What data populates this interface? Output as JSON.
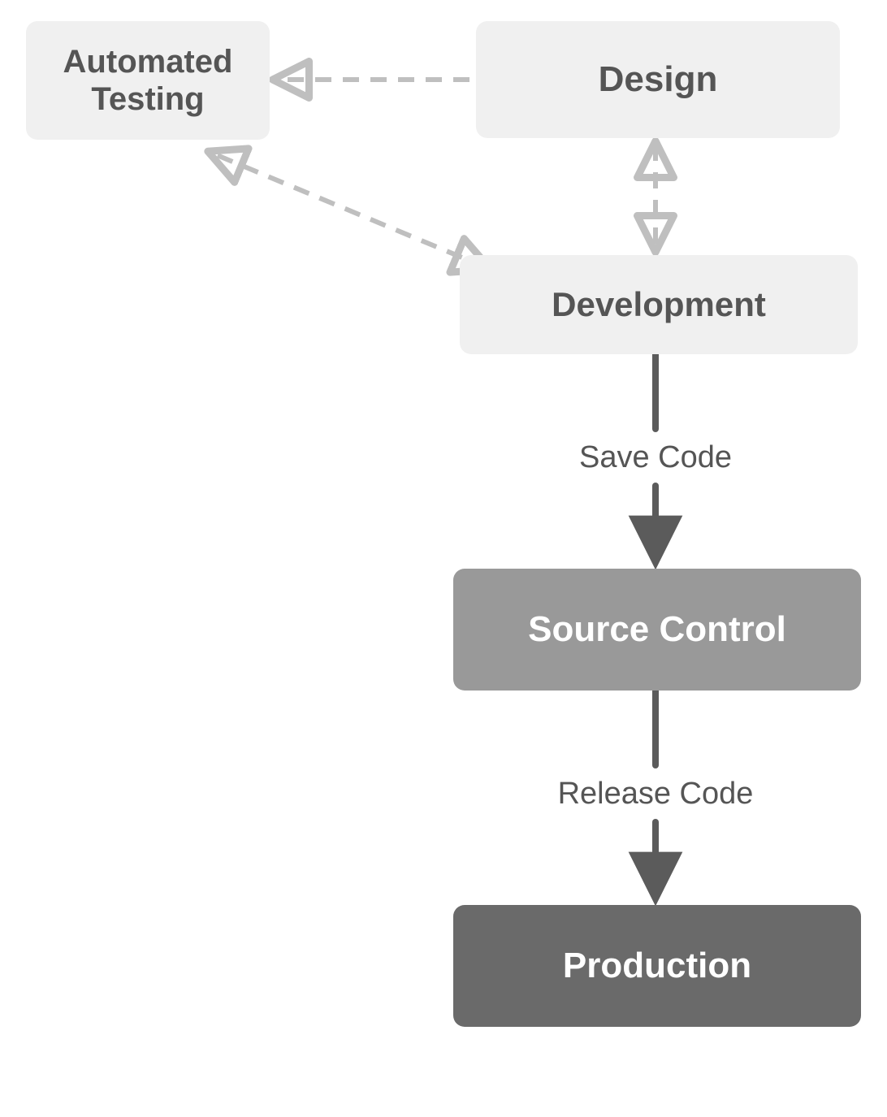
{
  "nodes": {
    "automated_testing": {
      "label": "Automated\nTesting"
    },
    "design": {
      "label": "Design"
    },
    "development": {
      "label": "Development"
    },
    "source_control": {
      "label": "Source Control"
    },
    "production": {
      "label": "Production"
    }
  },
  "edges": {
    "save_code": {
      "label": "Save Code"
    },
    "release_code": {
      "label": "Release Code"
    }
  },
  "palette": {
    "node_light_bg": "#f0f0f0",
    "node_light_fg": "#555555",
    "node_mid_bg": "#999999",
    "node_mid_fg": "#ffffff",
    "node_dark_bg": "#6a6a6a",
    "node_dark_fg": "#ffffff",
    "arrow_solid": "#5b5b5b",
    "arrow_dashed": "#bfbfbf"
  },
  "diagram": {
    "connections": [
      {
        "from": "design",
        "to": "automated_testing",
        "style": "dashed",
        "direction": "one-way"
      },
      {
        "from": "design",
        "to": "development",
        "style": "dashed",
        "direction": "two-way"
      },
      {
        "from": "development",
        "to": "automated_testing",
        "style": "dashed",
        "direction": "two-way"
      },
      {
        "from": "development",
        "to": "source_control",
        "style": "solid",
        "direction": "one-way",
        "label_key": "save_code"
      },
      {
        "from": "source_control",
        "to": "production",
        "style": "solid",
        "direction": "one-way",
        "label_key": "release_code"
      }
    ]
  }
}
